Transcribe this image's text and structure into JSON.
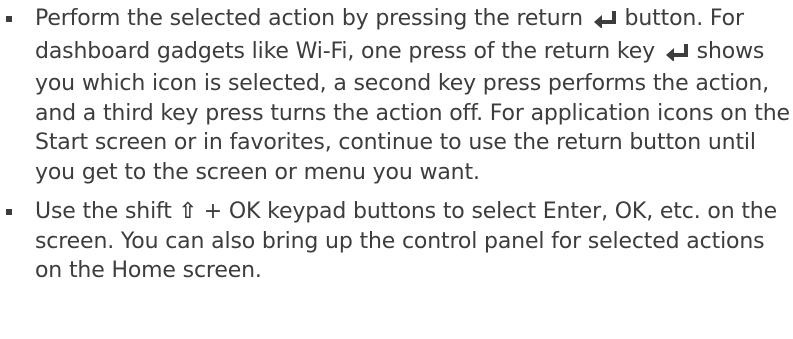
{
  "bullets": [
    {
      "segments": [
        {
          "type": "text",
          "value": "Perform the selected action by pressing the return "
        },
        {
          "type": "icon",
          "icon": "return-key-icon"
        },
        {
          "type": "text",
          "value": " button. For dashboard gadgets like Wi-Fi, one press of the return key "
        },
        {
          "type": "icon",
          "icon": "return-key-icon"
        },
        {
          "type": "text",
          "value": " shows you which icon is selected, a second key press performs the action, and a third key press turns the action off. For application icons on the Start screen or in favorites, continue to use the return button until you get to the screen or menu you want."
        }
      ]
    },
    {
      "segments": [
        {
          "type": "text",
          "value": "Use the shift "
        },
        {
          "type": "icon",
          "icon": "shift-key-icon",
          "glyph": "⇧"
        },
        {
          "type": "text",
          "value": " + OK keypad buttons to select Enter, OK, etc. on the screen. You can also bring up the control panel for selected actions on the Home screen."
        }
      ]
    }
  ],
  "colors": {
    "text": "#3d3d3d",
    "background": "#ffffff"
  }
}
